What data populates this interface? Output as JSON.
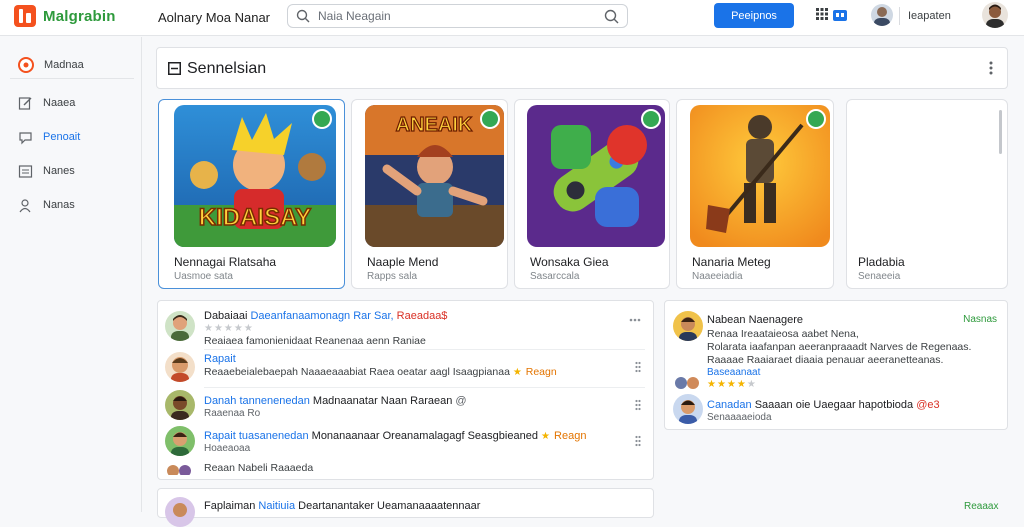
{
  "header": {
    "brand": "Malgrabin",
    "app_title": "Aolnary Moa Nanar",
    "search_placeholder": "Naia Neagain",
    "primary_button": "Peeipnos",
    "user_name": "Ieapaten"
  },
  "sidebar": {
    "items": [
      {
        "label": "Madnaa",
        "icon": "home-icon"
      },
      {
        "label": "Naaea",
        "icon": "edit-icon"
      },
      {
        "label": "Penoait",
        "icon": "chat-icon"
      },
      {
        "label": "Nanes",
        "icon": "list-icon"
      },
      {
        "label": "Nanas",
        "icon": "person-icon"
      }
    ]
  },
  "section": {
    "title": "Sennelsian"
  },
  "games": [
    {
      "title": "Nennagai Rlatsaha",
      "subtitle": "Uasmoe sata",
      "art_text": "KIDAISAY",
      "colors": [
        "#2f8fd8",
        "#f6b52a"
      ]
    },
    {
      "title": "Naaple Mend",
      "subtitle": "Rapps sala",
      "art_text": "ANEAIK",
      "colors": [
        "#2a3a6a",
        "#d8762a"
      ]
    },
    {
      "title": "Wonsaka Giea",
      "subtitle": "Sasarccala",
      "art_text": "",
      "colors": [
        "#5b2a8c",
        "#8ac43a"
      ]
    },
    {
      "title": "Nanaria Meteg",
      "subtitle": "Naaeeiadia",
      "art_text": "",
      "colors": [
        "#f08a1d",
        "#ffcb3c"
      ]
    },
    {
      "title": "Pladabia",
      "subtitle": "Senaeeia",
      "art_text": "",
      "colors": []
    }
  ],
  "reviews": [
    {
      "name": "Dabaiaai",
      "tag": "Daeanfanaamonagn Rar Sar,",
      "badge": "Raeadaa$",
      "text": "Reaiaea famonienidaat Reanenaa aenn Raniae",
      "meta": "",
      "stars": 0
    },
    {
      "name": "Rapait",
      "tag": "",
      "badge": "",
      "text": "Reaaebeialebaepah Naaaeaaabiat Raea oeatar aagl Isaagpianaa",
      "meta": "",
      "extra": "Reagn",
      "stars": 1
    },
    {
      "name": "Danah",
      "tag": "tannenenedan",
      "badge": "",
      "text": "Madnaanatar Naan Raraean",
      "meta": "Raaenaa Ro",
      "stars": 0
    },
    {
      "name": "Rapait",
      "tag": "tuasanenedan",
      "badge": "",
      "text": "Monanaanaar Oreanamalagagf Seasgbieaned",
      "meta": "Hoaeaoaa",
      "extra": "Reagn",
      "stars": 1
    },
    {
      "name": "",
      "tag": "",
      "badge": "",
      "text": "Reaan Nabeli Raaaeda",
      "meta": "",
      "stars": 0
    }
  ],
  "side_panel": {
    "title": "Nabean Naenagere",
    "status": "Nasnas",
    "body": [
      "Renaa Ireaataieosa aabet Nena,",
      "Rolarata iaafanpan aeeranpraaadt Narves de Regenaas.",
      "Raaaae Raaiaraet diaaia penauar aeeranetteanas."
    ],
    "meta": "Baseaanaat",
    "commenter": "Canadan",
    "comment": "Saaaan oie Uaegaar hapotbioda",
    "comment_badge": "@e3",
    "comment_meta": "Senaaaaeioda"
  },
  "bottom": {
    "name": "Faplaiman",
    "tag": "Naitiuia",
    "text": "Deartanantaker Ueamanaaaatennaar",
    "status": "Reaaax"
  }
}
